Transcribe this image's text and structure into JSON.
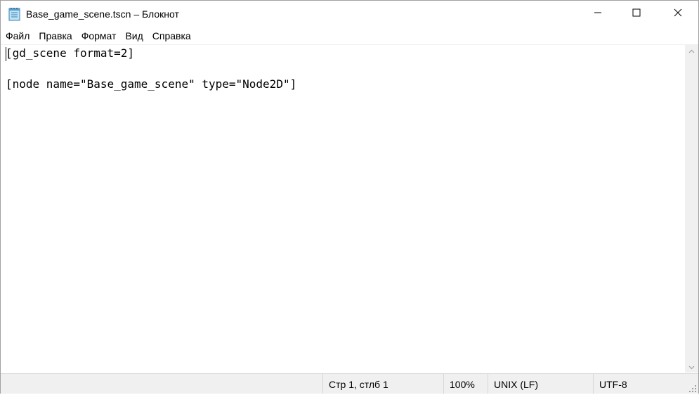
{
  "window": {
    "title": "Base_game_scene.tscn – Блокнот",
    "icon": "notepad-icon"
  },
  "controls": {
    "minimize_icon": "minimize-icon",
    "maximize_icon": "maximize-icon",
    "close_icon": "close-icon"
  },
  "menu": {
    "items": [
      "Файл",
      "Правка",
      "Формат",
      "Вид",
      "Справка"
    ]
  },
  "editor": {
    "lines": [
      "[gd_scene format=2]",
      "[node name=\"Base_game_scene\" type=\"Node2D\"]"
    ]
  },
  "status": {
    "position": "Стр 1, стлб 1",
    "zoom": "100%",
    "line_ending": "UNIX (LF)",
    "encoding": "UTF-8"
  }
}
